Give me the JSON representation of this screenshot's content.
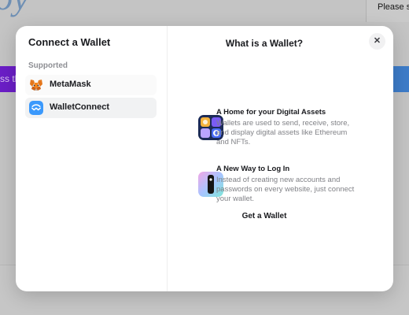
{
  "background": {
    "logo_fragment": "oy",
    "right_text": "Please se",
    "purple_button_text": "ss th"
  },
  "modal": {
    "title": "Connect a Wallet",
    "section_label": "Supported",
    "wallets": [
      {
        "label": "MetaMask",
        "icon": "metamask-fox-icon"
      },
      {
        "label": "WalletConnect",
        "icon": "walletconnect-icon"
      }
    ],
    "close_label": "✕",
    "info": {
      "title": "What is a Wallet?",
      "features": [
        {
          "title": "A Home for your Digital Assets",
          "description": "Wallets are used to send, receive, store, and display digital assets like Ethereum and NFTs.",
          "icon": "digital-assets-icon"
        },
        {
          "title": "A New Way to Log In",
          "description": "Instead of creating new accounts and passwords on every website, just connect your wallet.",
          "icon": "login-key-icon"
        }
      ],
      "cta_label": "Get a Wallet"
    }
  },
  "colors": {
    "walletconnect_blue": "#3b99fc",
    "bg_purple": "#6b1ec7",
    "bg_blue": "#3d7cc9"
  }
}
